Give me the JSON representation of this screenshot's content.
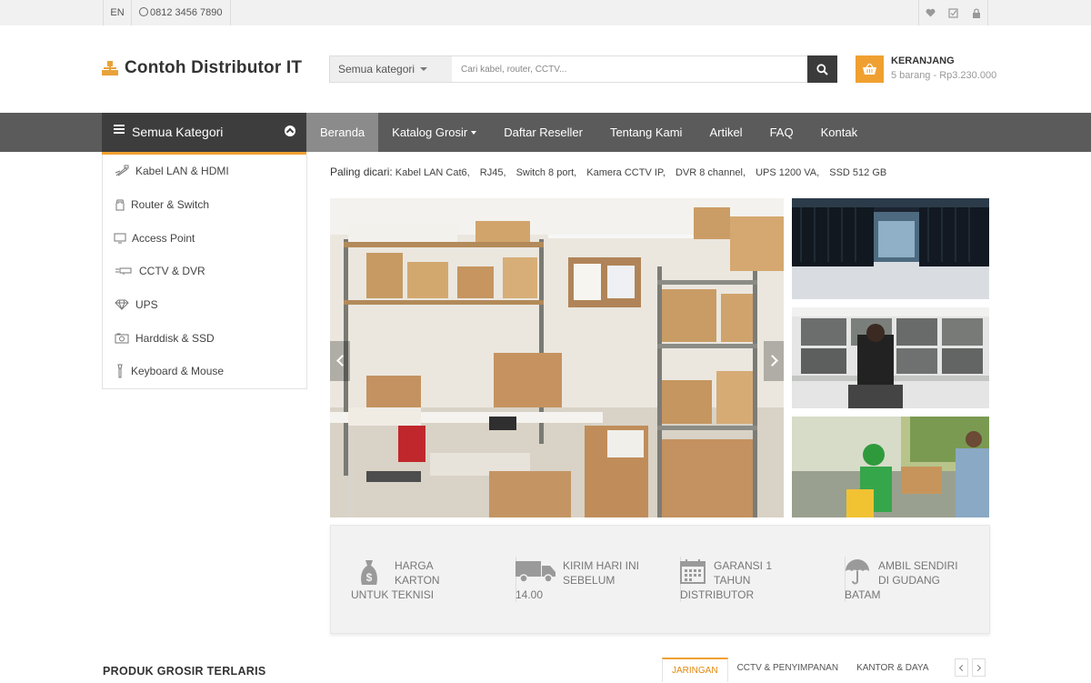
{
  "topbar": {
    "language": "EN",
    "phone": "0812 3456 7890",
    "icons": [
      "heart-icon",
      "checkbox-icon",
      "lock-icon"
    ]
  },
  "header": {
    "site_title": "Contoh Distributor IT",
    "search": {
      "category_label": "Semua kategori",
      "placeholder": "Cari kabel, router, CCTV...",
      "value": ""
    },
    "cart": {
      "label": "KERANJANG",
      "summary": "5 barang - Rp3.230.000"
    }
  },
  "nav": {
    "all_categories": "Semua Kategori",
    "items": [
      {
        "label": "Beranda",
        "active": true
      },
      {
        "label": "Katalog Grosir",
        "dropdown": true
      },
      {
        "label": "Daftar Reseller"
      },
      {
        "label": "Tentang Kami"
      },
      {
        "label": "Artikel"
      },
      {
        "label": "FAQ"
      },
      {
        "label": "Kontak"
      }
    ]
  },
  "sidebar": {
    "items": [
      {
        "label": "Kabel LAN & HDMI",
        "icon": "cable-icon"
      },
      {
        "label": "Router & Switch",
        "icon": "router-icon"
      },
      {
        "label": "Access Point",
        "icon": "monitor-icon"
      },
      {
        "label": "CCTV & DVR",
        "icon": "camera-icon"
      },
      {
        "label": "UPS",
        "icon": "diamond-icon"
      },
      {
        "label": "Harddisk & SSD",
        "icon": "disk-icon"
      },
      {
        "label": "Keyboard & Mouse",
        "icon": "mouse-icon"
      }
    ]
  },
  "popular": {
    "label": "Paling dicari:",
    "terms": [
      "Kabel LAN Cat6,",
      "RJ45,",
      "Switch 8 port,",
      "Kamera CCTV IP,",
      "DVR 8 channel,",
      "UPS 1200 VA,",
      "SSD 512 GB"
    ]
  },
  "features": [
    {
      "line1": "HARGA",
      "line2": "KARTON",
      "line3": "UNTUK TEKNISI",
      "icon": "money-bag-icon"
    },
    {
      "line1": "KIRIM HARI INI",
      "line2": "SEBELUM",
      "line3": "14.00",
      "icon": "truck-icon"
    },
    {
      "line1": "GARANSI 1",
      "line2": "TAHUN",
      "line3": "DISTRIBUTOR",
      "icon": "calendar-icon"
    },
    {
      "line1": "AMBIL SENDIRI",
      "line2": "DI GUDANG",
      "line3": "BATAM",
      "icon": "umbrella-icon"
    }
  ],
  "products": {
    "heading": "PRODUK GROSIR TERLARIS",
    "tabs": [
      {
        "label": "JARINGAN",
        "active": true
      },
      {
        "label": "CCTV & PENYIMPANAN"
      },
      {
        "label": "KANTOR & DAYA"
      }
    ]
  },
  "colors": {
    "accent": "#f0a030",
    "nav_bg": "#5b5b5b",
    "nav_dark": "#3d3d3d",
    "nav_active": "#8b8b8b"
  }
}
